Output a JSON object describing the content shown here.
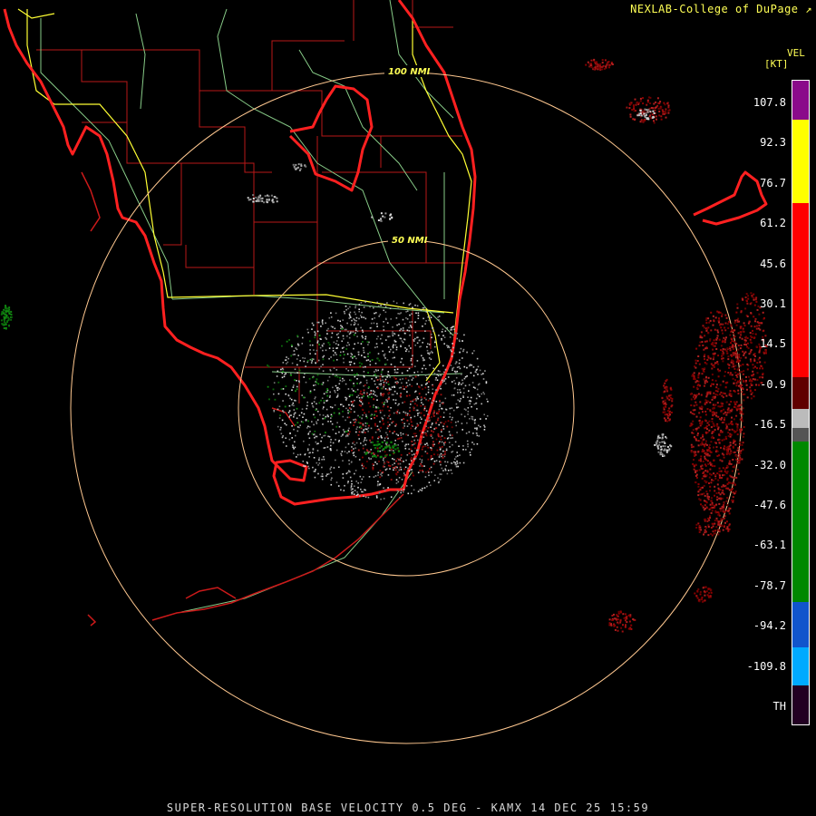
{
  "header": {
    "credit": "NEXLAB-College of DuPage",
    "credit_icon": "external-link-icon"
  },
  "footer": {
    "caption": "SUPER-RESOLUTION BASE VELOCITY 0.5 DEG - KAMX 14 DEC 25 15:59"
  },
  "map": {
    "range_rings": [
      {
        "label": "100 NMI",
        "radius_nmi": 100
      },
      {
        "label": "50 NMI",
        "radius_nmi": 50
      }
    ],
    "colors": {
      "coastline": "#ff2020",
      "county_lines": "#b81818",
      "state_roads": "#ffff33",
      "highways": "#88cc88",
      "ring": "#ffc890"
    }
  },
  "legend": {
    "title": "VEL",
    "units": "[KT]",
    "ticks": [
      "107.8",
      "92.3",
      "76.7",
      "61.2",
      "45.6",
      "30.1",
      "14.5",
      "-0.9",
      "-16.5",
      "-32.0",
      "-47.6",
      "-63.1",
      "-78.7",
      "-94.2",
      "-109.8",
      "TH"
    ],
    "colors": [
      {
        "from": 0.0,
        "to": 0.06,
        "color": "#8a0a8a"
      },
      {
        "from": 0.06,
        "to": 0.19,
        "color": "#ffff00"
      },
      {
        "from": 0.19,
        "to": 0.46,
        "color": "#ff0000"
      },
      {
        "from": 0.46,
        "to": 0.51,
        "color": "#600000"
      },
      {
        "from": 0.51,
        "to": 0.54,
        "color": "#bbbbbb"
      },
      {
        "from": 0.54,
        "to": 0.56,
        "color": "#555555"
      },
      {
        "from": 0.56,
        "to": 0.81,
        "color": "#008800"
      },
      {
        "from": 0.81,
        "to": 0.88,
        "color": "#1155cc"
      },
      {
        "from": 0.88,
        "to": 0.94,
        "color": "#00aaff"
      },
      {
        "from": 0.94,
        "to": 1.0,
        "color": "#220022"
      }
    ]
  }
}
